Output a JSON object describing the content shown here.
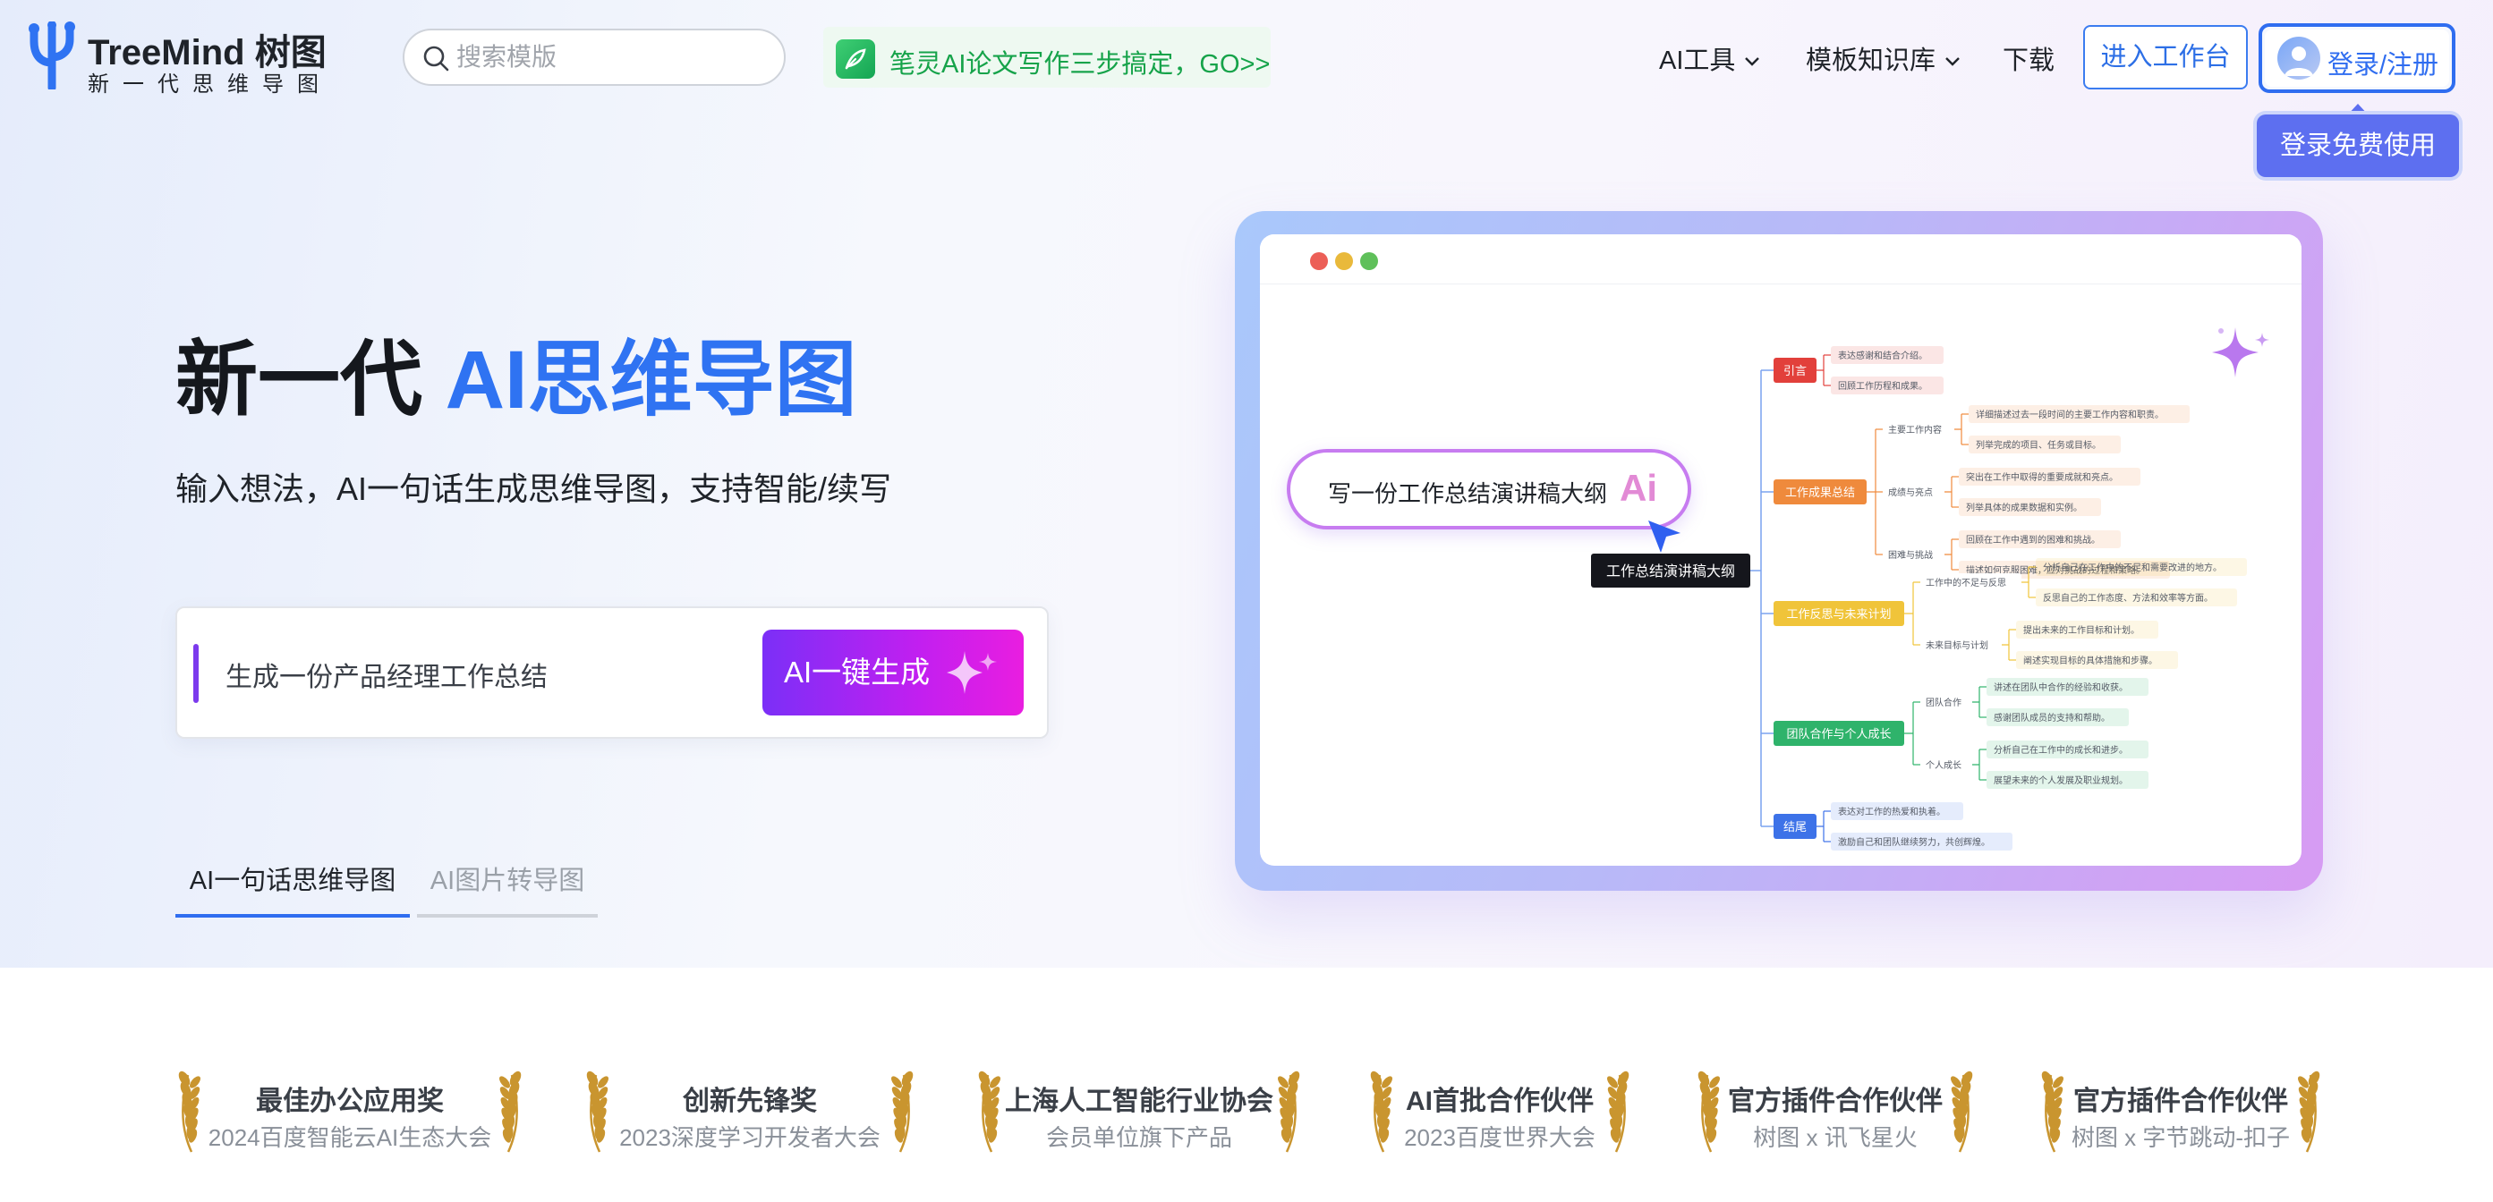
{
  "header": {
    "logo_title": "TreeMind 树图",
    "logo_subtitle": "新一代思维导图",
    "search_placeholder": "搜索模版",
    "promo_text": "笔灵AI论文写作三步搞定，GO>>",
    "nav": {
      "ai_tools": "AI工具",
      "template_library": "模板知识库",
      "download": "下载"
    },
    "workspace_button": "进入工作台",
    "login_button": "登录/注册",
    "login_tooltip": "登录免费使用"
  },
  "hero": {
    "title_prefix": "新一代 ",
    "title_accent": "AI思维导图",
    "subtitle": "输入想法，AI一句话生成思维导图，支持智能/续写",
    "input_value": "生成一份产品经理工作总结",
    "generate_button": "AI一键生成",
    "tabs": [
      {
        "label": "AI一句话思维导图",
        "active": true
      },
      {
        "label": "AI图片转导图",
        "active": false
      }
    ]
  },
  "preview": {
    "prompt_text": "写一份工作总结演讲稿大纲",
    "ai_badge": "Ai",
    "root": "工作总结演讲稿大纲",
    "branches": [
      {
        "label": "引言",
        "color": "#e2403b",
        "items": [
          "表达感谢和结合介绍。",
          "回顾工作历程和成果。"
        ]
      },
      {
        "label": "工作成果总结",
        "color": "#ef8a3c",
        "groups": [
          {
            "label": "主要工作内容",
            "items": [
              "详细描述过去一段时间的主要工作内容和职责。",
              "列举完成的项目、任务或目标。"
            ]
          },
          {
            "label": "成绩与亮点",
            "items": [
              "突出在工作中取得的重要成就和亮点。",
              "列举具体的成果数据和实例。"
            ]
          },
          {
            "label": "困难与挑战",
            "items": [
              "回顾在工作中遇到的困难和挑战。",
              "描述如何克服困难，应对挑战的过程和策略。"
            ]
          }
        ]
      },
      {
        "label": "工作反思与未来计划",
        "color": "#f0c43a",
        "groups": [
          {
            "label": "工作中的不足与反思",
            "items": [
              "分析自己在工作中的不足和需要改进的地方。",
              "反思自己的工作态度、方法和效率等方面。"
            ]
          },
          {
            "label": "未来目标与计划",
            "items": [
              "提出未来的工作目标和计划。",
              "阐述实现目标的具体措施和步骤。"
            ]
          }
        ]
      },
      {
        "label": "团队合作与个人成长",
        "color": "#2fb36b",
        "groups": [
          {
            "label": "团队合作",
            "items": [
              "讲述在团队中合作的经验和收获。",
              "感谢团队成员的支持和帮助。"
            ]
          },
          {
            "label": "个人成长",
            "items": [
              "分析自己在工作中的成长和进步。",
              "展望未来的个人发展及职业规划。"
            ]
          }
        ]
      },
      {
        "label": "结尾",
        "color": "#3d72e8",
        "items": [
          "表达对工作的热爱和执着。",
          "激励自己和团队继续努力，共创辉煌。"
        ]
      }
    ]
  },
  "awards": [
    {
      "title": "最佳办公应用奖",
      "subtitle": "2024百度智能云AI生态大会"
    },
    {
      "title": "创新先锋奖",
      "subtitle": "2023深度学习开发者大会"
    },
    {
      "title": "上海人工智能行业协会",
      "subtitle": "会员单位旗下产品"
    },
    {
      "title": "AI首批合作伙伴",
      "subtitle": "2023百度世界大会"
    },
    {
      "title": "官方插件合作伙伴",
      "subtitle": "树图 x 讯飞星火"
    },
    {
      "title": "官方插件合作伙伴",
      "subtitle": "树图 x 字节跳动-扣子"
    }
  ],
  "colors": {
    "brand_blue": "#2f6df0",
    "accent_purple": "#7b2ff7",
    "accent_magenta": "#e91ee0",
    "promo_green": "#16a34a",
    "laurel_gold": "#c9952f"
  },
  "icons": [
    "treemind-logo-icon",
    "search-icon",
    "feather-icon",
    "chevron-down-icon",
    "user-avatar-icon",
    "sparkle-icon",
    "cursor-icon",
    "laurel-icon"
  ]
}
